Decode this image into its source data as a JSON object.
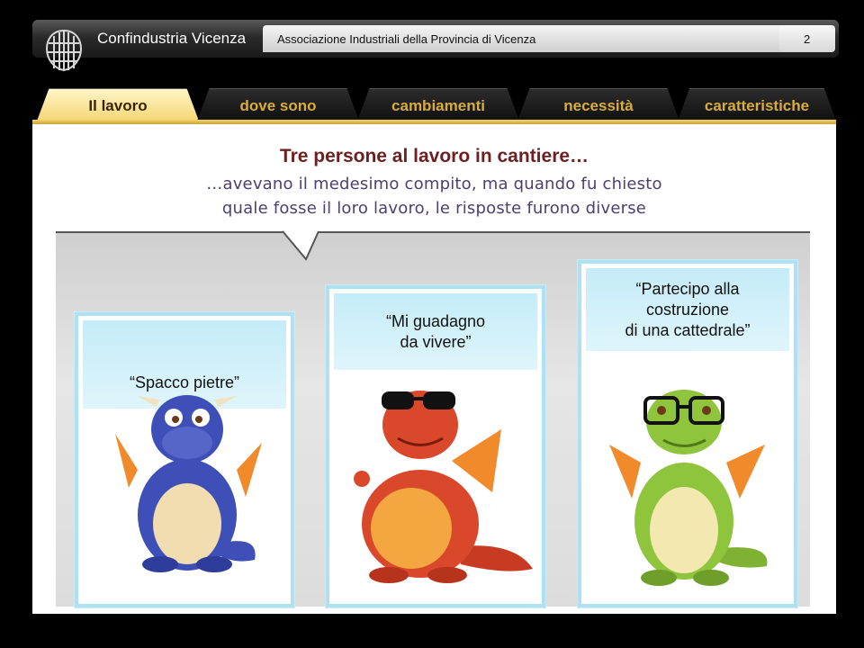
{
  "header": {
    "brand": "Confindustria Vicenza",
    "association": "Associazione Industriali della Provincia di Vicenza",
    "page_number": "2"
  },
  "nav": {
    "tabs": [
      {
        "label": "Il lavoro",
        "active": true
      },
      {
        "label": "dove sono",
        "active": false
      },
      {
        "label": "cambiamenti",
        "active": false
      },
      {
        "label": "necessità",
        "active": false
      },
      {
        "label": "caratteristiche",
        "active": false
      }
    ]
  },
  "slide": {
    "title": "Tre persone al lavoro in cantiere…",
    "subtitle_line1": "…avevano il medesimo compito, ma quando fu chiesto",
    "subtitle_line2": "quale fosse il loro lavoro, le risposte furono diverse"
  },
  "cards": [
    {
      "label_lines": [
        "“Spacco pietre”"
      ],
      "dragon_color": "#3e4fb8",
      "accessory": "none"
    },
    {
      "label_lines": [
        "“Mi guadagno",
        "da vivere”"
      ],
      "dragon_color": "#d9482b",
      "accessory": "sunglasses"
    },
    {
      "label_lines": [
        "“Partecipo alla",
        "costruzione",
        "di una cattedrale”"
      ],
      "dragon_color": "#8fc43d",
      "accessory": "glasses"
    }
  ],
  "colors": {
    "tab_active_bg": "#f6d46d",
    "tab_text": "#d9ad3a",
    "title": "#6e1f1f",
    "subtitle": "#4d4070",
    "card_border": "#aee1f1"
  }
}
